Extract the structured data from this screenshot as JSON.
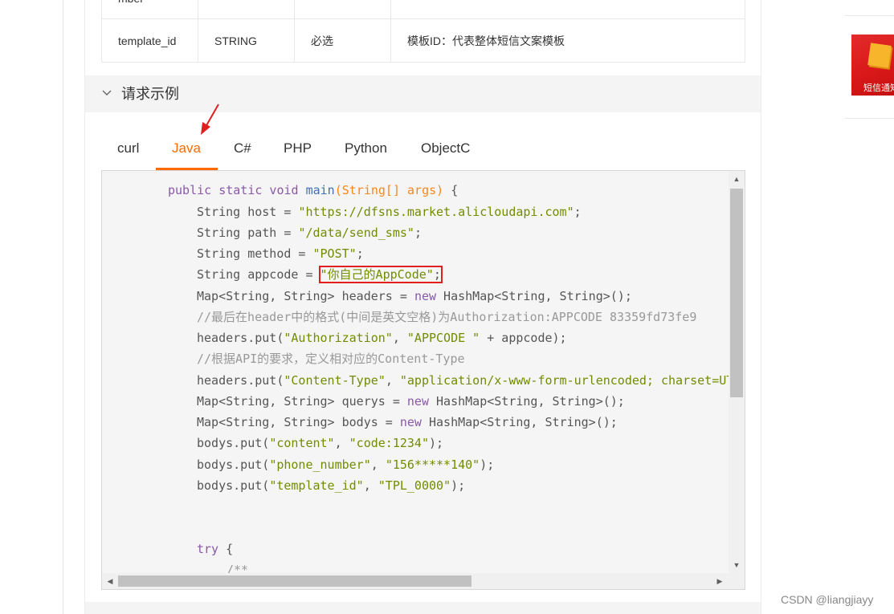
{
  "param_table": {
    "prev_row_fragment": "mber",
    "row": {
      "name": "template_id",
      "type": "STRING",
      "required": "必选",
      "description": "模板ID：代表整体短信文案模板"
    }
  },
  "section": {
    "title": "请求示例",
    "toggle_icon": "chevron-down-icon"
  },
  "tabs": [
    {
      "label": "curl",
      "active": false
    },
    {
      "label": "Java",
      "active": true
    },
    {
      "label": "C#",
      "active": false
    },
    {
      "label": "PHP",
      "active": false
    },
    {
      "label": "Python",
      "active": false
    },
    {
      "label": "ObjectC",
      "active": false
    }
  ],
  "code": {
    "l1": {
      "kw1": "public static void ",
      "fn": "main",
      "params": "(String[] args)",
      "brace": " {"
    },
    "l2": {
      "pre": "String host = ",
      "str": "\"https://dfsns.market.alicloudapi.com\"",
      "post": ";"
    },
    "l3": {
      "pre": "String path = ",
      "str": "\"/data/send_sms\"",
      "post": ";"
    },
    "l4": {
      "pre": "String method = ",
      "str": "\"POST\"",
      "post": ";"
    },
    "l5": {
      "pre": "String appcode = ",
      "str": "\"你自己的AppCode\"",
      "post": ";"
    },
    "l6": {
      "pre": "Map<String, String> headers = ",
      "kw": "new",
      "post": " HashMap<String, String>();"
    },
    "l7": {
      "comment": "//最后在header中的格式(中间是英文空格)为Authorization:APPCODE 83359fd73fe9"
    },
    "l8": {
      "pre": "headers.put(",
      "str1": "\"Authorization\"",
      "mid": ", ",
      "str2": "\"APPCODE \"",
      "post": " + appcode);"
    },
    "l9": {
      "comment": "//根据API的要求，定义相对应的Content-Type"
    },
    "l10": {
      "pre": "headers.put(",
      "str1": "\"Content-Type\"",
      "mid": ", ",
      "str2": "\"application/x-www-form-urlencoded; charset=UT"
    },
    "l11": {
      "pre": "Map<String, String> querys = ",
      "kw": "new",
      "post": " HashMap<String, String>();"
    },
    "l12": {
      "pre": "Map<String, String> bodys = ",
      "kw": "new",
      "post": " HashMap<String, String>();"
    },
    "l13": {
      "pre": "bodys.put(",
      "str1": "\"content\"",
      "mid": ", ",
      "str2": "\"code:1234\"",
      "post": ");"
    },
    "l14": {
      "pre": "bodys.put(",
      "str1": "\"phone_number\"",
      "mid": ", ",
      "str2": "\"156*****140\"",
      "post": ");"
    },
    "l15": {
      "pre": "bodys.put(",
      "str1": "\"template_id\"",
      "mid": ", ",
      "str2": "\"TPL_0000\"",
      "post": ");"
    },
    "l16": {
      "kw": "try",
      "post": " {"
    },
    "l17": {
      "comment": "/**"
    }
  },
  "ad": {
    "label": "短信通知"
  },
  "watermark": "CSDN @liangjiayy",
  "colors": {
    "accent": "#ff6a00",
    "annotation_red": "#e02020"
  }
}
